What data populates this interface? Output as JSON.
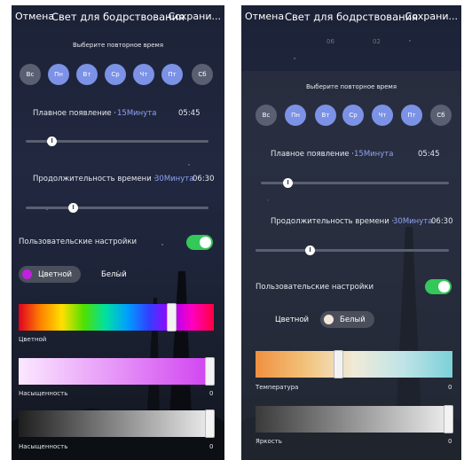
{
  "screen1": {
    "cancel": "Отмена",
    "title": "Свет для бодрствования",
    "save": "Сохрани...",
    "repeat_label": "Выберите повторное время",
    "days": [
      "Вс",
      "Пн",
      "Вт",
      "Ср",
      "Чт",
      "Пт",
      "Сб"
    ],
    "smooth_label": "Плавное появление ·",
    "smooth_value": "15Минута",
    "smooth_time": "05:45",
    "duration_label": "Продолжительность времени ·",
    "duration_value": "30Минута",
    "duration_time": "06:30",
    "custom_label": "Пользовательские настройки",
    "mode_color": "Цветной",
    "mode_white": "Белый",
    "hue_label": "Цветной",
    "sat_label": "Насыщенность",
    "sat_value": "0",
    "bright_label": "Насыщенность",
    "bright_value": "0"
  },
  "screen2": {
    "cancel": "Отмена",
    "title": "Свет для бодрствования",
    "save": "Сохрани...",
    "wheel_h": "06",
    "wheel_m": "02",
    "repeat_label": "Выберите повторное время",
    "days": [
      "Вс",
      "Пн",
      "Вт",
      "Ср",
      "Чт",
      "Пт",
      "Сб"
    ],
    "smooth_label": "Плавное появление ·",
    "smooth_value": "15Минута",
    "smooth_time": "05:45",
    "duration_label": "Продолжительность времени ·",
    "duration_value": "30Минута",
    "duration_time": "06:30",
    "custom_label": "Пользовательские настройки",
    "mode_color": "Цветной",
    "mode_white": "Белый",
    "temp_label": "Температура",
    "temp_value": "0",
    "bright_label": "Яркость",
    "bright_value": "0"
  },
  "selected_days": [
    "Пн",
    "Вт",
    "Ср",
    "Чт",
    "Пт"
  ],
  "slider_icon": "I",
  "colors": {
    "accent": "#8fa2f0",
    "day_selected": "#7b92e6",
    "day_unselected": "#5a6072",
    "toggle_on": "#34c759",
    "color_mode_dot": "#c020e0",
    "white_mode_dot": "#f5e6dc"
  }
}
